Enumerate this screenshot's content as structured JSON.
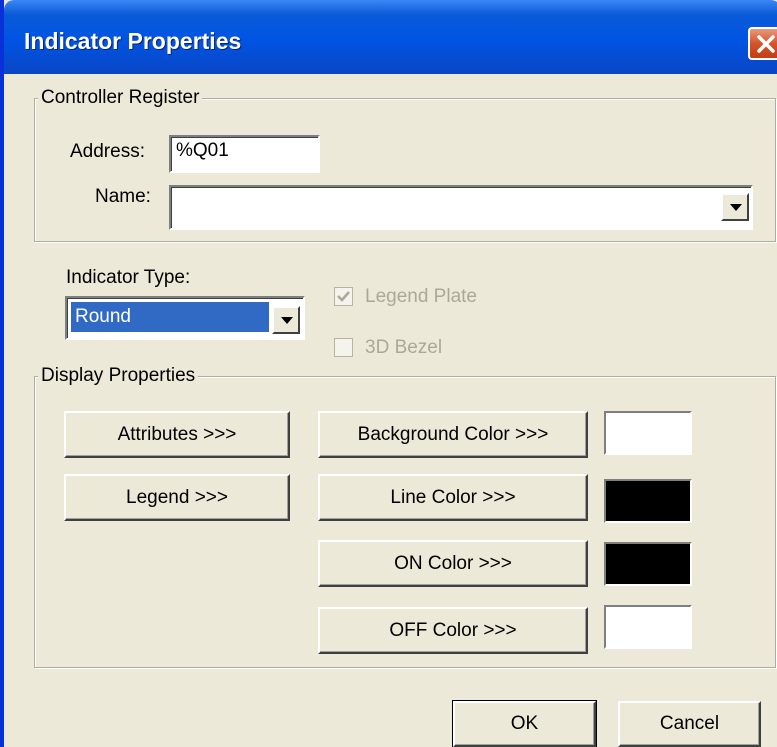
{
  "window": {
    "title": "Indicator Properties",
    "close_icon": "close-x-icon"
  },
  "controller_register": {
    "legend": "Controller Register",
    "address_label": "Address:",
    "address_value": "%Q01",
    "name_label": "Name:",
    "name_value": ""
  },
  "indicator_type": {
    "label": "Indicator Type:",
    "selected": "Round"
  },
  "options": {
    "legend_plate_label": "Legend Plate",
    "legend_plate_checked": true,
    "bezel_3d_label": "3D Bezel",
    "bezel_3d_checked": false
  },
  "display_properties": {
    "legend": "Display Properties",
    "attributes_button": "Attributes >>>",
    "legend_button": "Legend >>>",
    "background_color_button": "Background Color >>>",
    "line_color_button": "Line Color >>>",
    "on_color_button": "ON Color >>>",
    "off_color_button": "OFF Color >>>",
    "colors": {
      "background": "#ffffff",
      "line": "#000000",
      "on": "#000000",
      "off": "#ffffff"
    }
  },
  "footer": {
    "ok_button": "OK",
    "cancel_button": "Cancel"
  }
}
